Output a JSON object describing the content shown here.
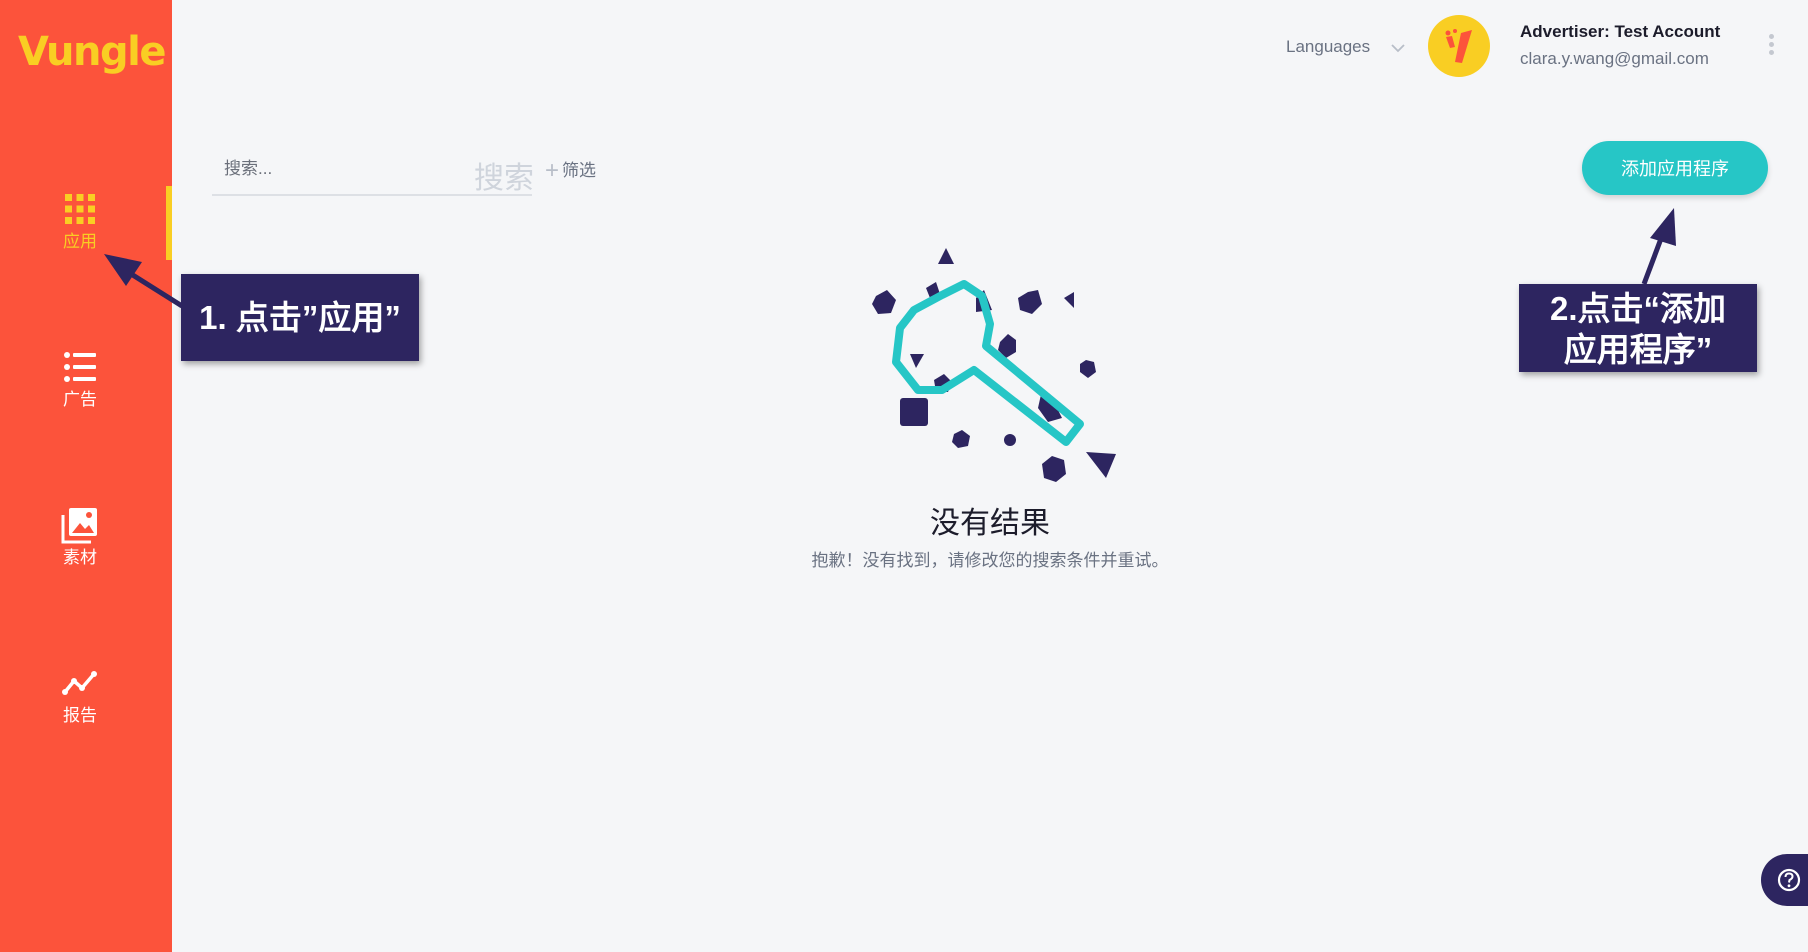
{
  "app": {
    "logo_text": "Vungle"
  },
  "sidebar": {
    "items": [
      {
        "label": "应用",
        "icon": "grid-icon",
        "active": true
      },
      {
        "label": "广告",
        "icon": "list-icon",
        "active": false
      },
      {
        "label": "素材",
        "icon": "images-icon",
        "active": false
      },
      {
        "label": "报告",
        "icon": "chart-line-icon",
        "active": false
      }
    ]
  },
  "header": {
    "languages_label": "Languages",
    "account_name": "Advertiser: Test Account",
    "account_email": "clara.y.wang@gmail.com"
  },
  "search": {
    "placeholder": "搜索...",
    "search_button_label": "搜索",
    "filter_plus": "+",
    "filter_label": "筛选"
  },
  "add_app_button": {
    "label": "添加应用程序"
  },
  "empty_state": {
    "title": "没有结果",
    "message": "抱歉！没有找到，请修改您的搜索条件并重试。"
  },
  "annotations": {
    "step1": "1. 点击”应用”",
    "step2_line1": "2.点击“添加",
    "step2_line2": "应用程序”"
  },
  "colors": {
    "sidebar": "#fc533b",
    "accent_yellow": "#f9ce23",
    "button_teal": "#26c6c6",
    "annotation_navy": "#2d2560"
  }
}
